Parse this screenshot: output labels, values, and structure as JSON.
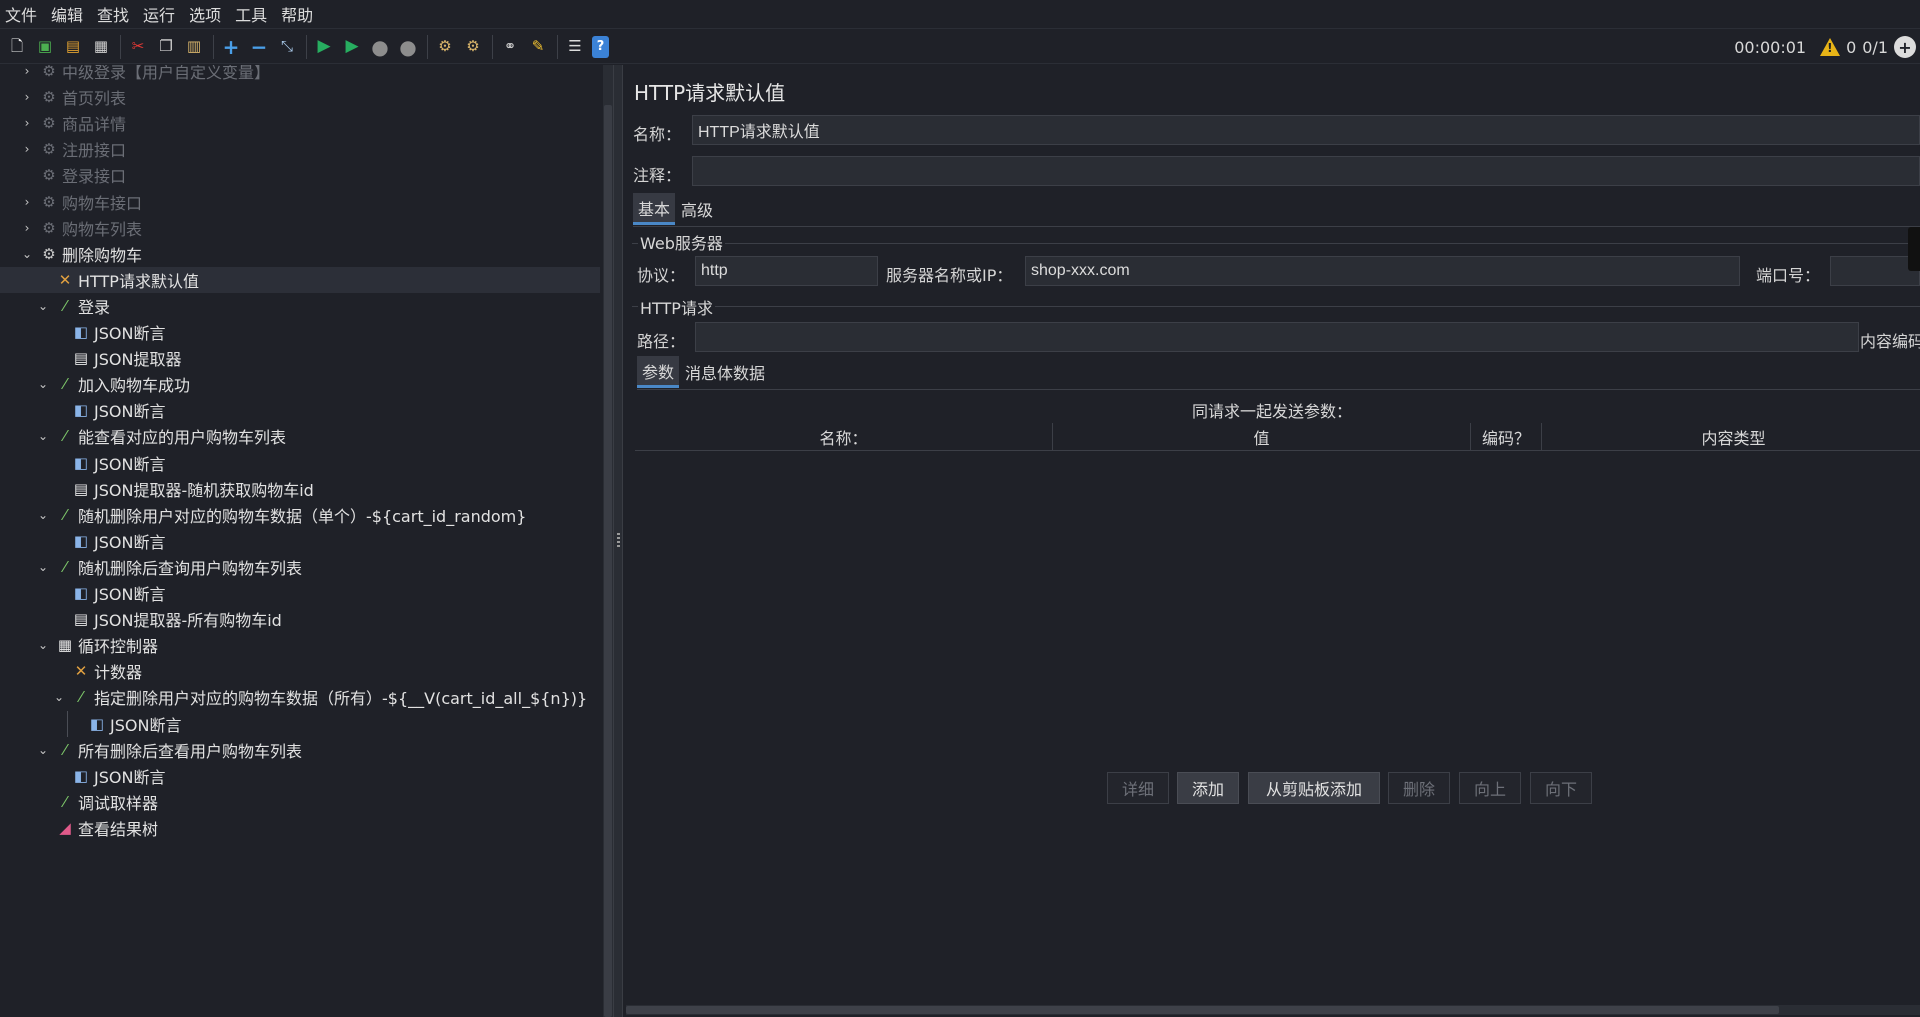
{
  "menu": [
    "文件",
    "编辑",
    "查找",
    "运行",
    "选项",
    "工具",
    "帮助"
  ],
  "toolbar": {
    "icons": [
      "new-icon",
      "templates-icon",
      "open-icon",
      "save-icon",
      "cut-icon",
      "copy-icon",
      "paste-icon",
      "expand-icon",
      "collapse-icon",
      "toggle-icon",
      "start-icon",
      "start-no-pause-icon",
      "stop-icon",
      "shutdown-icon",
      "clear-icon",
      "clear-all-icon",
      "search-icon",
      "reset-search-icon",
      "function-helper-icon",
      "help-icon"
    ],
    "timer": "00:00:01",
    "warnings": "0",
    "threads": "0/1"
  },
  "tree": [
    {
      "label": "中级登录【用户自定义变量】",
      "icon": "gear-icon",
      "indent": 0,
      "arrow": "right",
      "disabled": true
    },
    {
      "label": "首页列表",
      "icon": "gear-icon",
      "indent": 0,
      "arrow": "right",
      "disabled": true
    },
    {
      "label": "商品详情",
      "icon": "gear-icon",
      "indent": 0,
      "arrow": "right",
      "disabled": true
    },
    {
      "label": "注册接口",
      "icon": "gear-icon",
      "indent": 0,
      "arrow": "right",
      "disabled": true
    },
    {
      "label": "登录接口",
      "icon": "gear-icon",
      "indent": 0,
      "arrow": "none",
      "disabled": true
    },
    {
      "label": "购物车接口",
      "icon": "gear-icon",
      "indent": 0,
      "arrow": "right",
      "disabled": true
    },
    {
      "label": "购物车列表",
      "icon": "gear-icon",
      "indent": 0,
      "arrow": "right",
      "disabled": true
    },
    {
      "label": "删除购物车",
      "icon": "gear-icon",
      "indent": 0,
      "arrow": "down",
      "disabled": false
    },
    {
      "label": "HTTP请求默认值",
      "icon": "tools-icon",
      "indent": 1,
      "arrow": "none",
      "disabled": false,
      "selected": true
    },
    {
      "label": "登录",
      "icon": "pipette-icon",
      "indent": 1,
      "arrow": "down",
      "disabled": false
    },
    {
      "label": "JSON断言",
      "icon": "assertion-icon",
      "indent": 2,
      "arrow": "none",
      "disabled": false
    },
    {
      "label": "JSON提取器",
      "icon": "extractor-icon",
      "indent": 2,
      "arrow": "none",
      "disabled": false
    },
    {
      "label": "加入购物车成功",
      "icon": "pipette-icon",
      "indent": 1,
      "arrow": "down",
      "disabled": false
    },
    {
      "label": "JSON断言",
      "icon": "assertion-icon",
      "indent": 2,
      "arrow": "none",
      "disabled": false
    },
    {
      "label": "能查看对应的用户购物车列表",
      "icon": "pipette-icon",
      "indent": 1,
      "arrow": "down",
      "disabled": false
    },
    {
      "label": "JSON断言",
      "icon": "assertion-icon",
      "indent": 2,
      "arrow": "none",
      "disabled": false
    },
    {
      "label": "JSON提取器-随机获取购物车id",
      "icon": "extractor-icon",
      "indent": 2,
      "arrow": "none",
      "disabled": false
    },
    {
      "label": "随机删除用户对应的购物车数据（单个）-${cart_id_random}",
      "icon": "pipette-icon",
      "indent": 1,
      "arrow": "down",
      "disabled": false
    },
    {
      "label": "JSON断言",
      "icon": "assertion-icon",
      "indent": 2,
      "arrow": "none",
      "disabled": false
    },
    {
      "label": "随机删除后查询用户购物车列表",
      "icon": "pipette-icon",
      "indent": 1,
      "arrow": "down",
      "disabled": false
    },
    {
      "label": "JSON断言",
      "icon": "assertion-icon",
      "indent": 2,
      "arrow": "none",
      "disabled": false
    },
    {
      "label": "JSON提取器-所有购物车id",
      "icon": "extractor-icon",
      "indent": 2,
      "arrow": "none",
      "disabled": false
    },
    {
      "label": "循环控制器",
      "icon": "loop-icon",
      "indent": 1,
      "arrow": "down",
      "disabled": false
    },
    {
      "label": "计数器",
      "icon": "tools-icon",
      "indent": 2,
      "arrow": "none",
      "disabled": false
    },
    {
      "label": "指定删除用户对应的购物车数据（所有）-${__V(cart_id_all_${n})}",
      "icon": "pipette-icon",
      "indent": 2,
      "arrow": "down",
      "disabled": false
    },
    {
      "label": "JSON断言",
      "icon": "assertion-icon",
      "indent": 3,
      "arrow": "none",
      "disabled": false
    },
    {
      "label": "所有删除后查看用户购物车列表",
      "icon": "pipette-icon",
      "indent": 1,
      "arrow": "down",
      "disabled": false
    },
    {
      "label": "JSON断言",
      "icon": "assertion-icon",
      "indent": 2,
      "arrow": "none",
      "disabled": false
    },
    {
      "label": "调试取样器",
      "icon": "pipette-icon",
      "indent": 1,
      "arrow": "none",
      "disabled": false
    },
    {
      "label": "查看结果树",
      "icon": "chart-icon",
      "indent": 1,
      "arrow": "none",
      "disabled": false
    }
  ],
  "panel": {
    "title": "HTTP请求默认值",
    "name_label": "名称：",
    "name_value": "HTTP请求默认值",
    "comment_label": "注释：",
    "comment_value": "",
    "tabs": {
      "basic": "基本",
      "advanced": "高级"
    },
    "web_server": {
      "section": "Web服务器",
      "protocol_label": "协议：",
      "protocol_value": "http",
      "server_label": "服务器名称或IP：",
      "server_value": "shop-xxx.com",
      "port_label": "端口号："
    },
    "http_request": {
      "section": "HTTP请求",
      "path_label": "路径：",
      "path_value": "",
      "encoding_label": "内容编码"
    },
    "subtabs": {
      "params": "参数",
      "body": "消息体数据"
    },
    "params_caption": "同请求一起发送参数：",
    "columns": [
      "名称：",
      "值",
      "编码？",
      "内容类型"
    ],
    "buttons": {
      "detail": "详细",
      "add": "添加",
      "add_clipboard": "从剪贴板添加",
      "delete": "删除",
      "up": "向上",
      "down": "向下"
    }
  }
}
